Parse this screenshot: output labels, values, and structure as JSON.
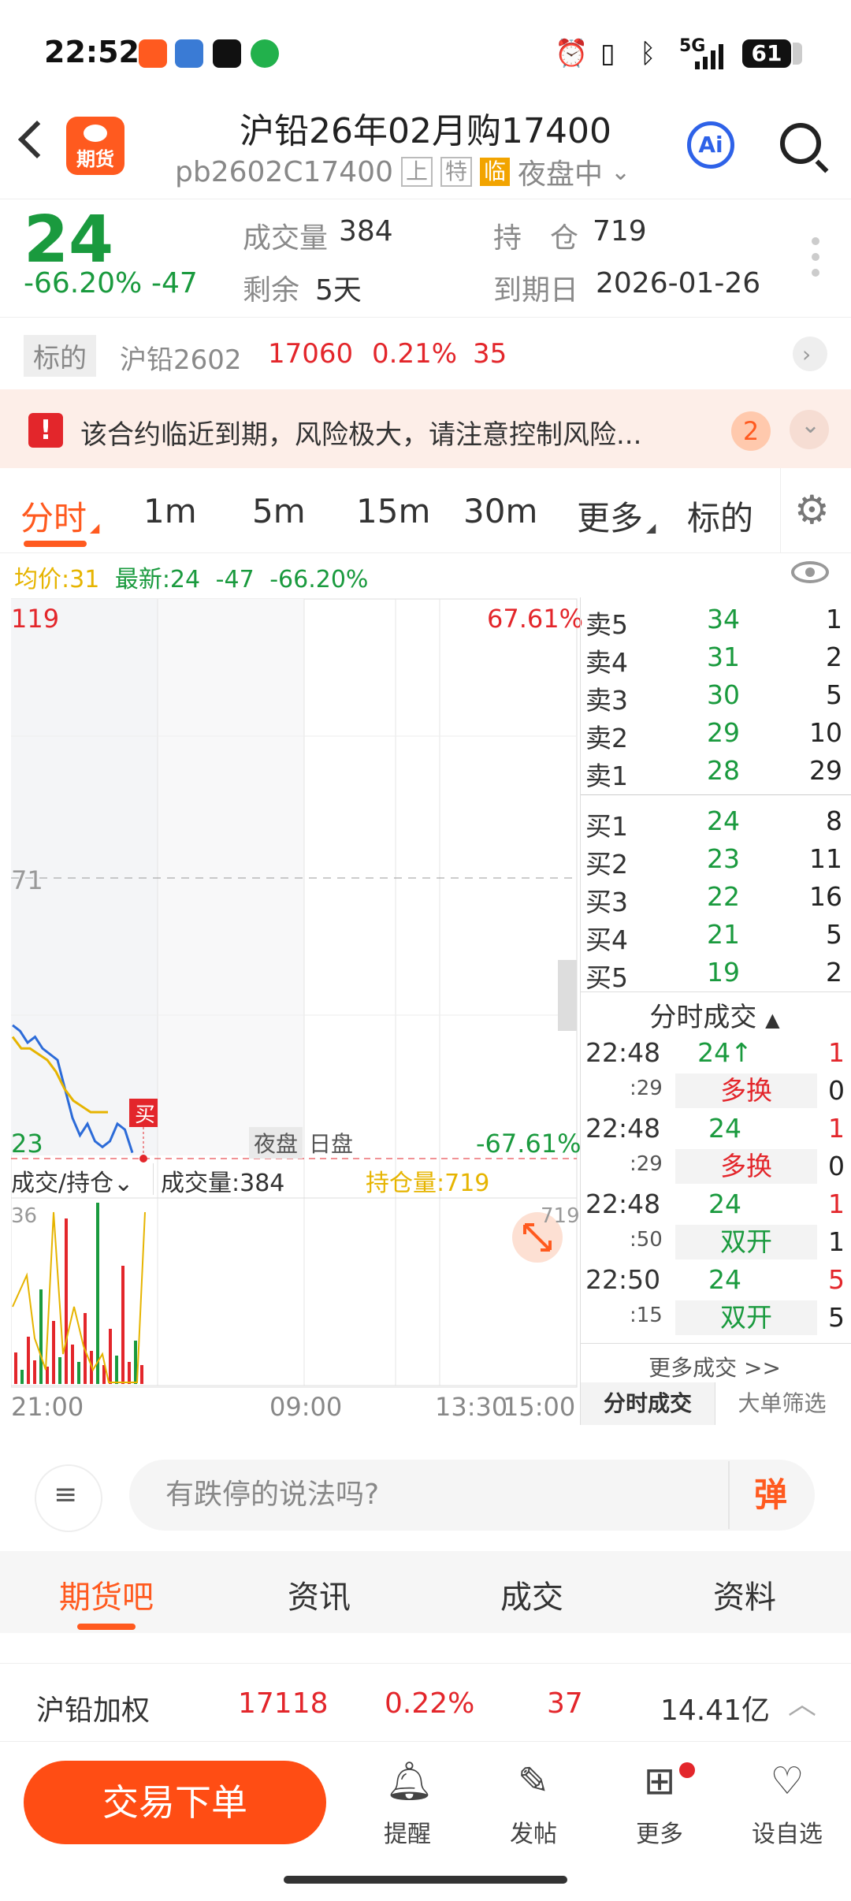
{
  "status_bar": {
    "time": "22:52",
    "battery": "61",
    "network": "5G"
  },
  "header": {
    "logo_text": "期货",
    "title": "沪铅26年02月购17400",
    "code": "pb2602C17400",
    "tag1": "上",
    "tag2": "特",
    "tag3": "临",
    "session": "夜盘中",
    "ai_label": "Ai"
  },
  "quote": {
    "price": "24",
    "change_pct": "-66.20%",
    "change": "-47",
    "volume_label": "成交量",
    "volume": "384",
    "oi_label": "持　仓",
    "oi": "719",
    "remain_label": "剩余",
    "remain": "5天",
    "expiry_label": "到期日",
    "expiry": "2026-01-26"
  },
  "underlying": {
    "label": "标的",
    "name": "沪铅2602",
    "price": "17060",
    "pct": "0.21%",
    "change": "35"
  },
  "alert": {
    "icon_text": "!",
    "text": "该合约临近到期，风险极大，请注意控制风险...",
    "count": "2"
  },
  "period_tabs": [
    {
      "label": "分时"
    },
    {
      "label": "1m"
    },
    {
      "label": "5m"
    },
    {
      "label": "15m"
    },
    {
      "label": "30m"
    },
    {
      "label": "更多"
    },
    {
      "label": "标的"
    }
  ],
  "indicators": {
    "avg": "均价:31",
    "latest": "最新:24",
    "change": "-47",
    "pct": "-66.20%"
  },
  "chart": {
    "y_top": "119",
    "y_mid": "71",
    "y_bottom": "23",
    "pct_top": "67.61%",
    "pct_bottom": "-67.61%",
    "session_night": "夜盘",
    "session_day": "日盘",
    "buy_marker": "买",
    "sub_selector": "成交/持仓",
    "sub_volume": "成交量:384",
    "sub_oi": "持仓量:719",
    "sub_ytop": "36",
    "sub_yright": "719",
    "time_labels": [
      "21:00",
      "09:00",
      "13:30",
      "15:00"
    ]
  },
  "chart_data": {
    "type": "line",
    "x": [
      "21:00",
      "09:00",
      "13:30",
      "15:00"
    ],
    "ylim": [
      23,
      119
    ],
    "series": [
      {
        "name": "最新",
        "color": "#2c6bd8",
        "values": [
          46,
          45,
          43,
          44,
          42,
          41,
          40,
          35,
          30,
          27,
          29,
          26,
          25,
          26,
          29,
          28,
          24
        ]
      },
      {
        "name": "均价",
        "color": "#e6b400",
        "values": [
          44,
          42,
          42,
          41,
          40,
          38,
          35,
          33,
          32,
          31,
          31,
          31
        ]
      }
    ]
  },
  "order_book": {
    "asks": [
      {
        "label": "卖5",
        "price": "34",
        "vol": "1"
      },
      {
        "label": "卖4",
        "price": "31",
        "vol": "2"
      },
      {
        "label": "卖3",
        "price": "30",
        "vol": "5"
      },
      {
        "label": "卖2",
        "price": "29",
        "vol": "10"
      },
      {
        "label": "卖1",
        "price": "28",
        "vol": "29"
      }
    ],
    "bids": [
      {
        "label": "买1",
        "price": "24",
        "vol": "8"
      },
      {
        "label": "买2",
        "price": "23",
        "vol": "11"
      },
      {
        "label": "买3",
        "price": "22",
        "vol": "16"
      },
      {
        "label": "买4",
        "price": "21",
        "vol": "5"
      },
      {
        "label": "买5",
        "price": "19",
        "vol": "2"
      }
    ],
    "trades_title": "分时成交",
    "trades": [
      {
        "time": "22:48",
        "sec": ":29",
        "price": "24↑",
        "vol": "1",
        "type": "多换",
        "type_vol": "0"
      },
      {
        "time": "22:48",
        "sec": ":29",
        "price": "24",
        "vol": "1",
        "type": "多换",
        "type_vol": "0"
      },
      {
        "time": "22:48",
        "sec": ":50",
        "price": "24",
        "vol": "1",
        "type": "双开",
        "type_vol": "1"
      },
      {
        "time": "22:50",
        "sec": ":15",
        "price": "24",
        "vol": "5",
        "type": "双开",
        "type_vol": "5"
      }
    ],
    "more": "更多成交 >>",
    "tab1": "分时成交",
    "tab2": "大单筛选"
  },
  "comment": {
    "placeholder": "有跌停的说法吗?",
    "dan": "弹"
  },
  "bottom_tabs": [
    {
      "label": "期货吧"
    },
    {
      "label": "资讯"
    },
    {
      "label": "成交"
    },
    {
      "label": "资料"
    }
  ],
  "summary": {
    "name": "沪铅加权",
    "price": "17118",
    "pct": "0.22%",
    "change": "37",
    "amount": "14.41亿"
  },
  "footer": {
    "trade": "交易下单",
    "remind": "提醒",
    "post": "发帖",
    "more": "更多",
    "watch": "设自选"
  }
}
